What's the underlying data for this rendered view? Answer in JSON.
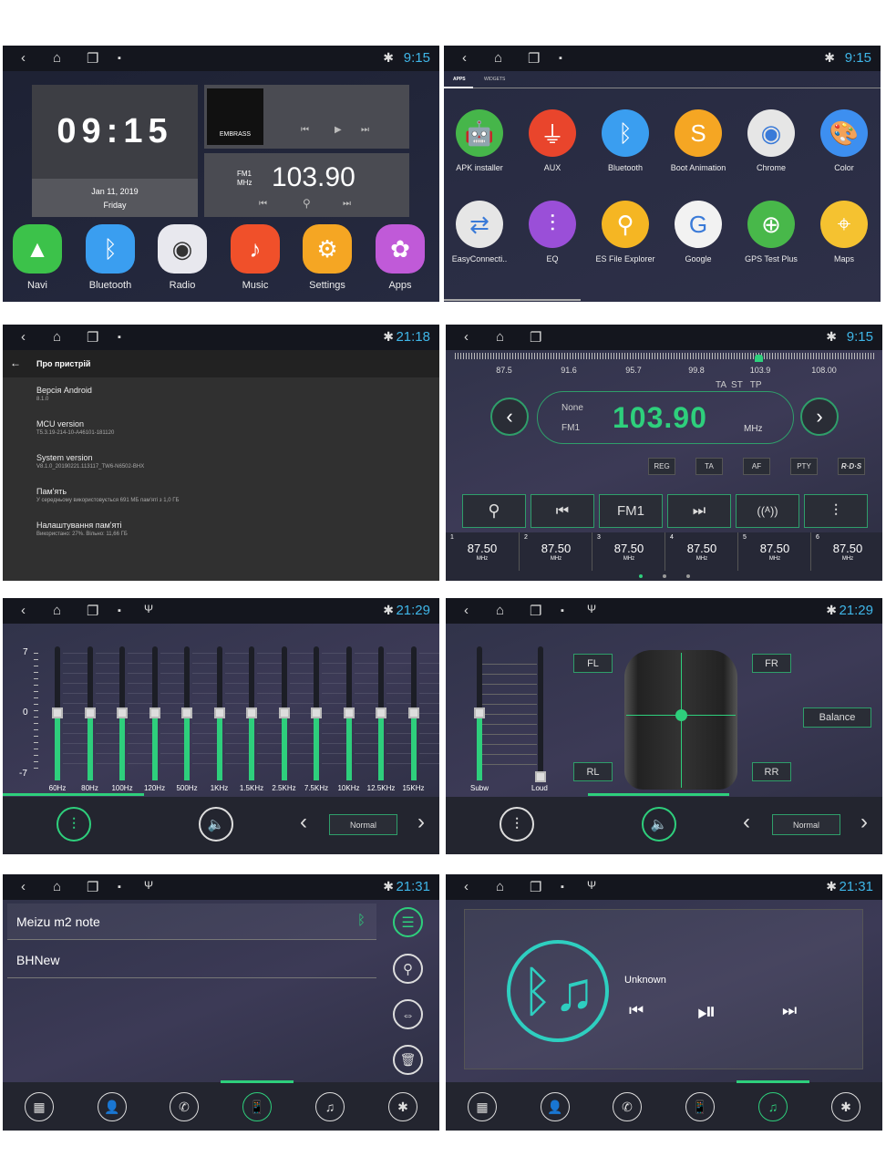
{
  "status": {
    "time_a": "9:15",
    "time_b": "21:18",
    "time_c": "21:29",
    "time_d": "21:31"
  },
  "home": {
    "clock": "09:15",
    "date": "Jan 11, 2019",
    "weekday": "Friday",
    "album_text": "EMBRASS",
    "radio_band": "FM1",
    "radio_unit": "MHz",
    "radio_freq": "103.90",
    "apps": [
      {
        "label": "Navi",
        "icon": "navigation-arrow-icon",
        "color": "#3cc24a"
      },
      {
        "label": "Bluetooth",
        "icon": "bluetooth-icon",
        "color": "#3a9ef0"
      },
      {
        "label": "Radio",
        "icon": "radio-dial-icon",
        "color": "#e8e8ee"
      },
      {
        "label": "Music",
        "icon": "music-note-icon",
        "color": "#f0502a"
      },
      {
        "label": "Settings",
        "icon": "gear-icon",
        "color": "#f5a623"
      },
      {
        "label": "Apps",
        "icon": "apps-flower-icon",
        "color": "#c05ad8"
      }
    ]
  },
  "drawer": {
    "tabs": [
      "APPS",
      "WIDGETS"
    ],
    "apps": [
      {
        "label": "APK installer",
        "icon": "android-icon",
        "color": "#46b64a",
        "glyph": "🤖"
      },
      {
        "label": "AUX",
        "icon": "aux-plug-icon",
        "color": "#e9452c",
        "glyph": "⏚"
      },
      {
        "label": "Bluetooth",
        "icon": "bluetooth-icon",
        "color": "#3a9ef0",
        "glyph": "ᛒ"
      },
      {
        "label": "Boot Animation",
        "icon": "boot-animation-icon",
        "color": "#f5a623",
        "glyph": "S"
      },
      {
        "label": "Chrome",
        "icon": "chrome-icon",
        "color": "#e6e6e6",
        "glyph": "◉"
      },
      {
        "label": "Color",
        "icon": "palette-icon",
        "color": "#3d8ff0",
        "glyph": "🎨"
      },
      {
        "label": "EasyConnecti..",
        "icon": "easyconnection-icon",
        "color": "#e6e6e6",
        "glyph": "⇄"
      },
      {
        "label": "EQ",
        "icon": "equalizer-icon",
        "color": "#9a4fd8",
        "glyph": "⫶"
      },
      {
        "label": "ES File Explorer",
        "icon": "file-explorer-icon",
        "color": "#f5b623",
        "glyph": "⚲"
      },
      {
        "label": "Google",
        "icon": "google-icon",
        "color": "#f2f2f2",
        "glyph": "G"
      },
      {
        "label": "GPS Test Plus",
        "icon": "gps-globe-icon",
        "color": "#48b84a",
        "glyph": "⊕"
      },
      {
        "label": "Maps",
        "icon": "maps-icon",
        "color": "#f5c230",
        "glyph": "⌖"
      }
    ]
  },
  "about": {
    "title": "Про пристрій",
    "items": [
      {
        "title": "Версія Android",
        "value": "8.1.0"
      },
      {
        "title": "MCU version",
        "value": "T5.3.19-214-10-A46101-181120"
      },
      {
        "title": "System version",
        "value": "V8.1.0_20190221.113117_TW6-N6502-BHX"
      },
      {
        "title": "Пам'ять",
        "value": "У середньому використовується 691 МБ пам'яті з 1,0 ГБ"
      },
      {
        "title": "Налаштування пам'яті",
        "value": "Використано: 27%. Вільно: 11,66 ГБ"
      }
    ]
  },
  "radio": {
    "scale": [
      "87.5",
      "91.6",
      "95.7",
      "99.8",
      "103.9",
      "108.00"
    ],
    "flags": "TA  ST   TP",
    "ps": "None",
    "band": "FM1",
    "freq": "103.90",
    "unit": "MHz",
    "opts": [
      "REG",
      "TA",
      "AF",
      "PTY",
      "R·D·S"
    ],
    "band_button": "FM1",
    "presets": [
      {
        "n": "1",
        "f": "87.50"
      },
      {
        "n": "2",
        "f": "87.50"
      },
      {
        "n": "3",
        "f": "87.50"
      },
      {
        "n": "4",
        "f": "87.50"
      },
      {
        "n": "5",
        "f": "87.50"
      },
      {
        "n": "6",
        "f": "87.50"
      }
    ],
    "preset_unit": "MHz",
    "page": 1,
    "pages": 3
  },
  "eq": {
    "scale": [
      "7",
      "0",
      "-7"
    ],
    "bands": [
      "60Hz",
      "80Hz",
      "100Hz",
      "120Hz",
      "500Hz",
      "1KHz",
      "1.5KHz",
      "2.5KHz",
      "7.5KHz",
      "10KHz",
      "12.5KHz",
      "15KHz"
    ],
    "values": [
      0,
      0,
      0,
      0,
      0,
      0,
      0,
      0,
      0,
      0,
      0,
      0
    ],
    "preset": "Normal",
    "accent": "#2ecf7c"
  },
  "balance": {
    "sub_label": "Subw",
    "loud_label": "Loud",
    "sub_value": 0,
    "fl": "FL",
    "fr": "FR",
    "rl": "RL",
    "rr": "RR",
    "balance": "Balance",
    "preset": "Normal"
  },
  "btlist": {
    "devices": [
      {
        "name": "Meizu m2 note",
        "connected": true
      },
      {
        "name": "BHNew",
        "connected": false
      }
    ]
  },
  "btmusic": {
    "title": "Unknown"
  }
}
